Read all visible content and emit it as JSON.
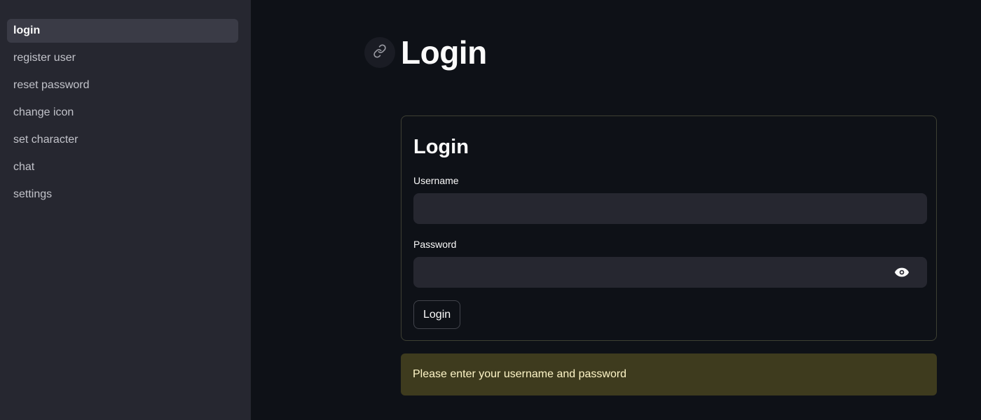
{
  "sidebar": {
    "items": [
      {
        "label": "login",
        "active": true
      },
      {
        "label": "register user"
      },
      {
        "label": "reset password"
      },
      {
        "label": "change icon"
      },
      {
        "label": "set character"
      },
      {
        "label": "chat"
      },
      {
        "label": "settings"
      }
    ]
  },
  "header": {
    "anchor_icon": "link-icon",
    "title": "Login"
  },
  "form": {
    "title": "Login",
    "username": {
      "label": "Username",
      "value": ""
    },
    "password": {
      "label": "Password",
      "value": "",
      "toggle_icon": "eye-icon"
    },
    "submit_label": "Login"
  },
  "alert": {
    "text": "Please enter your username and password",
    "background": "#3e3b1e",
    "text_color": "#fff6c8"
  },
  "colors": {
    "background": "#0e1117",
    "sidebar": "#262730",
    "input": "#262730"
  }
}
